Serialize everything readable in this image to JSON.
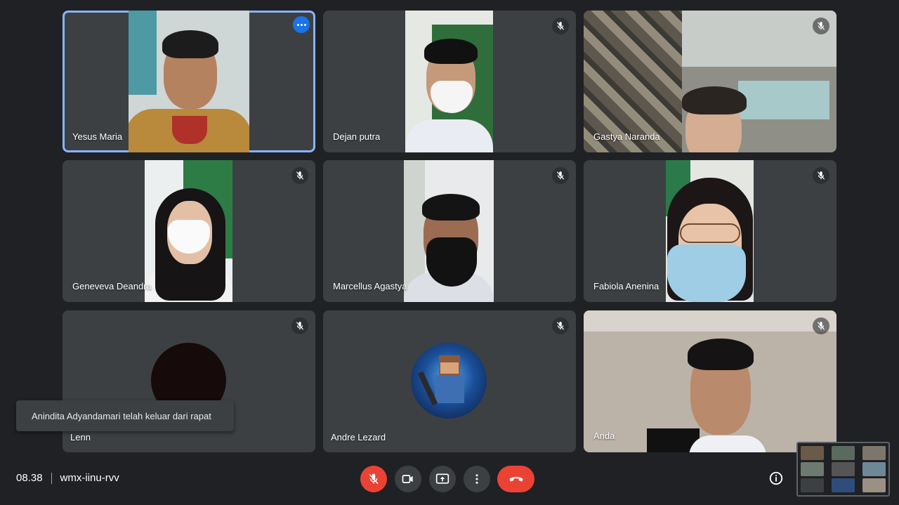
{
  "participants": [
    {
      "name": "Yesus Maria"
    },
    {
      "name": "Dejan putra"
    },
    {
      "name": "Gastya Naranda"
    },
    {
      "name": "Geneveva Deandra"
    },
    {
      "name": "Marcellus Agastya"
    },
    {
      "name": "Fabiola Anenina"
    },
    {
      "name": "Lenn"
    },
    {
      "name": "Andre Lezard"
    },
    {
      "name": "Anda"
    }
  ],
  "toast": {
    "message": "Anindita Adyandamari telah keluar dari rapat"
  },
  "meeting": {
    "time": "08.38",
    "code": "wmx-iinu-rvv"
  },
  "controls": {
    "mic": "mic-off-icon",
    "camera": "camera-icon",
    "present": "present-screen-icon",
    "more": "more-vert-icon",
    "hangup": "hang-up-icon",
    "info": "info-icon"
  },
  "colors": {
    "accent": "#8ab4f8",
    "danger": "#ea4335",
    "tile": "#3c4043",
    "background": "#202124"
  }
}
